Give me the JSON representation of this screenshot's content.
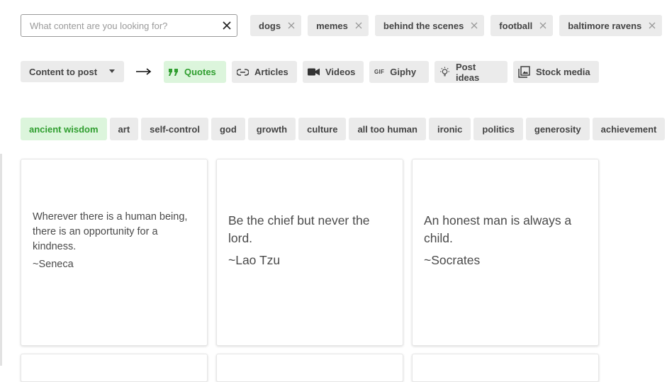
{
  "search": {
    "placeholder": "What content are you looking for?",
    "value": ""
  },
  "topic_tags": [
    "dogs",
    "memes",
    "behind the scenes",
    "football",
    "baltimore ravens"
  ],
  "content_select": {
    "label": "Content to post"
  },
  "content_types": [
    {
      "label": "Quotes",
      "icon": "quote-icon",
      "active": true
    },
    {
      "label": "Articles",
      "icon": "link-icon",
      "active": false
    },
    {
      "label": "Videos",
      "icon": "video-camera-icon",
      "active": false
    },
    {
      "label": "Giphy",
      "icon": "gif-icon",
      "icon_text": "GIF",
      "active": false
    },
    {
      "label": "Post ideas",
      "icon": "lightbulb-icon",
      "active": false
    },
    {
      "label": "Stock media",
      "icon": "image-gallery-icon",
      "active": false
    }
  ],
  "categories": [
    {
      "label": "ancient wisdom",
      "active": true
    },
    {
      "label": "art"
    },
    {
      "label": "self-control"
    },
    {
      "label": "god"
    },
    {
      "label": "growth"
    },
    {
      "label": "culture"
    },
    {
      "label": "all too human"
    },
    {
      "label": "ironic"
    },
    {
      "label": "politics"
    },
    {
      "label": "generosity"
    },
    {
      "label": "achievement"
    }
  ],
  "quotes": [
    {
      "text": "Wherever there is a human being, there is an opportunity for a kindness.",
      "author": "~Seneca"
    },
    {
      "text": "Be the chief but never the lord.",
      "author": "~Lao Tzu"
    },
    {
      "text": "An honest man is always a child.",
      "author": "~Socrates"
    }
  ],
  "colors": {
    "accent_green": "#2f9e2f",
    "accent_green_bg": "#dcf5dc",
    "chip_bg": "#ebebeb"
  }
}
